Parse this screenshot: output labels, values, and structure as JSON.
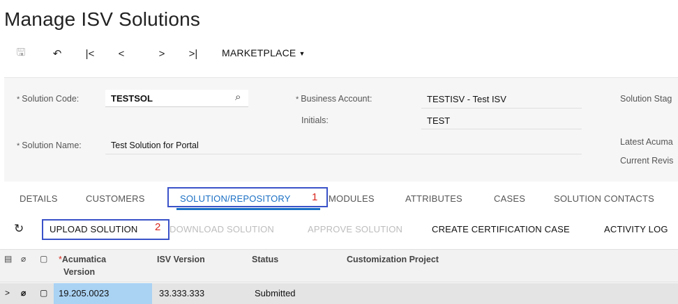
{
  "page": {
    "title": "Manage ISV Solutions"
  },
  "toolbar": {
    "icons": [
      "save-icon",
      "undo-icon",
      "first-record-icon",
      "previous-record-icon",
      "next-record-icon",
      "last-record-icon"
    ],
    "glyphs": {
      "save": "🖫",
      "undo": "↶",
      "first": "|<",
      "prev": "<",
      "next": ">",
      "last": ">|"
    },
    "menu_label": "MARKETPLACE",
    "menu_caret": "▼"
  },
  "form": {
    "solution_code_label": "Solution Code:",
    "solution_code_value": "TESTSOL",
    "search_glyph": "⌕",
    "business_account_label": "Business Account:",
    "business_account_value": "TESTISV - Test ISV",
    "initials_label": "Initials:",
    "initials_value": "TEST",
    "solution_name_label": "Solution Name:",
    "solution_name_value": "Test Solution for Portal",
    "solution_stage_label": "Solution Stag",
    "latest_acumatica_label": "Latest Acuma",
    "current_revision_label": "Current Revis",
    "required_marker": "*"
  },
  "tabs": {
    "items": [
      "DETAILS",
      "CUSTOMERS",
      "SOLUTION/REPOSITORY",
      "MODULES",
      "ATTRIBUTES",
      "CASES",
      "SOLUTION CONTACTS"
    ],
    "active": "SOLUTION/REPOSITORY",
    "callout_1": "1"
  },
  "actions": {
    "refresh_glyph": "↻",
    "upload": "UPLOAD SOLUTION",
    "download": "DOWNLOAD SOLUTION",
    "approve": "APPROVE SOLUTION",
    "create_case": "CREATE CERTIFICATION CASE",
    "activity_log": "ACTIVITY LOG",
    "callout_2": "2"
  },
  "grid": {
    "header_icons": {
      "layout": "▤",
      "attachment": "⌀",
      "note": "▢"
    },
    "required_marker": "*",
    "columns": [
      "Acumatica",
      "Version",
      "ISV Version",
      "Status",
      "Customization Project"
    ],
    "rows": [
      {
        "expand": ">",
        "attach": "⌀",
        "note": "▢",
        "acumatica_version": "19.205.0023",
        "isv_version": "33.333.333",
        "status": "Submitted",
        "customization_project": ""
      }
    ]
  },
  "colors": {
    "accent": "#1a6fc4",
    "highlight_box": "#3a52c8",
    "callout": "#d9261c",
    "selected_cell": "#aad2f3"
  }
}
